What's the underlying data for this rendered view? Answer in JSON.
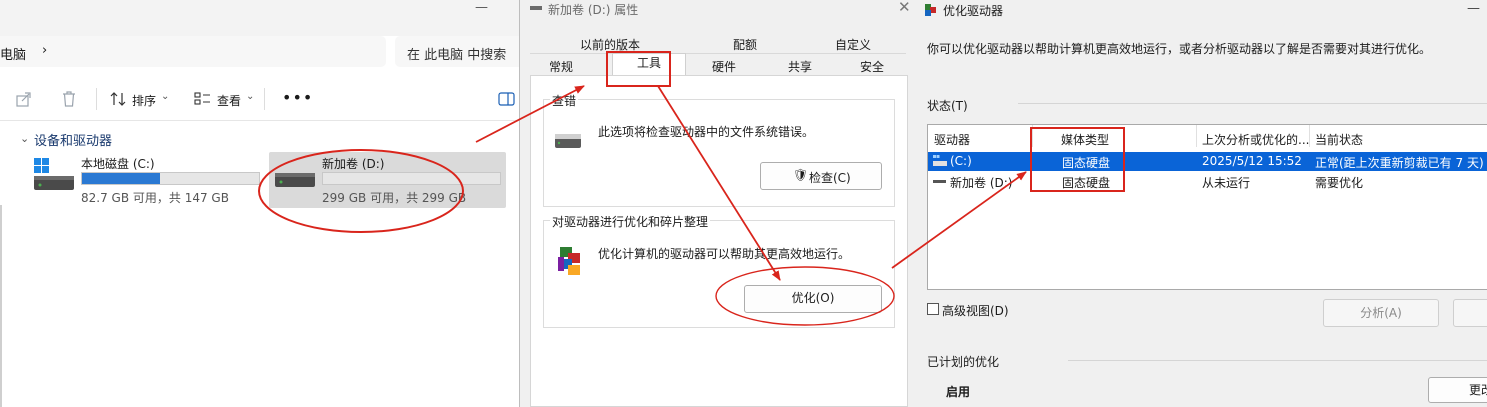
{
  "explorer": {
    "address_text": "电脑",
    "search_placeholder": "在 此电脑 中搜索",
    "toolbar": {
      "sort_label": "排序",
      "view_label": "查看"
    },
    "section_title": "设备和驱动器",
    "drives": [
      {
        "label": "本地磁盘 (C:)",
        "free_text": "82.7 GB 可用，共 147 GB",
        "used_fraction": 0.44
      },
      {
        "label": "新加卷 (D:)",
        "free_text": "299 GB 可用，共 299 GB",
        "used_fraction": 0.0
      }
    ]
  },
  "properties": {
    "title": "新加卷 (D:) 属性",
    "tabs_row1": [
      "以前的版本",
      "配额",
      "自定义"
    ],
    "tabs_row2": [
      "常规",
      "工具",
      "硬件",
      "共享",
      "安全"
    ],
    "active_tab": "工具",
    "check_group": {
      "title": "查错",
      "desc": "此选项将检查驱动器中的文件系统错误。",
      "button": "检查(C)"
    },
    "optimize_group": {
      "title": "对驱动器进行优化和碎片整理",
      "desc": "优化计算机的驱动器可以帮助其更高效地运行。",
      "button": "优化(O)"
    }
  },
  "optimize_window": {
    "title": "优化驱动器",
    "description": "你可以优化驱动器以帮助计算机更高效地运行，或者分析驱动器以了解是否需要对其进行优化。",
    "status_label": "状态(T)",
    "columns": [
      "驱动器",
      "媒体类型",
      "上次分析或优化的...",
      "当前状态"
    ],
    "rows": [
      {
        "drive": "(C:)",
        "media": "固态硬盘",
        "last": "2025/5/12 15:52",
        "status": "正常(距上次重新剪裁已有 7 天)",
        "selected": true
      },
      {
        "drive": "新加卷 (D:)",
        "media": "固态硬盘",
        "last": "从未运行",
        "status": "需要优化",
        "selected": false
      }
    ],
    "advanced_view": "高级视图(D)",
    "analyze_button": "分析(A)",
    "optimize_button": "",
    "scheduled_label": "已计划的优化",
    "enabled_label": "启用",
    "change_button": "更改"
  },
  "colors": {
    "annotation_red": "#d9251c",
    "selection_blue": "#0a64d7",
    "usage_bar_blue": "#2b79d3"
  }
}
